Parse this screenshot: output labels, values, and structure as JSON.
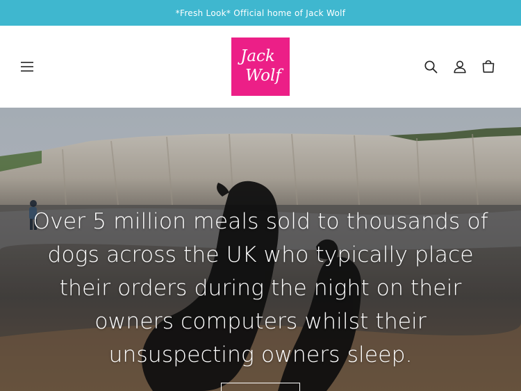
{
  "announcement": {
    "text": "*Fresh Look* Official home of Jack Wolf"
  },
  "header": {
    "logo": {
      "text_line1": "Jack",
      "text_line2": "Wolf",
      "bg_color": "#ec1f87"
    },
    "icons": {
      "menu": "hamburger-menu-icon",
      "search": "search-icon",
      "account": "account-icon",
      "cart": "cart-icon"
    }
  },
  "hero": {
    "headline": "Over 5 million meals sold to thousands of dogs across the UK who typically place their orders during the night on their owners computers whilst their unsuspecting owners sleep."
  },
  "colors": {
    "announcement_bg": "#3fb7cf",
    "logo_bg": "#ec1f87"
  }
}
